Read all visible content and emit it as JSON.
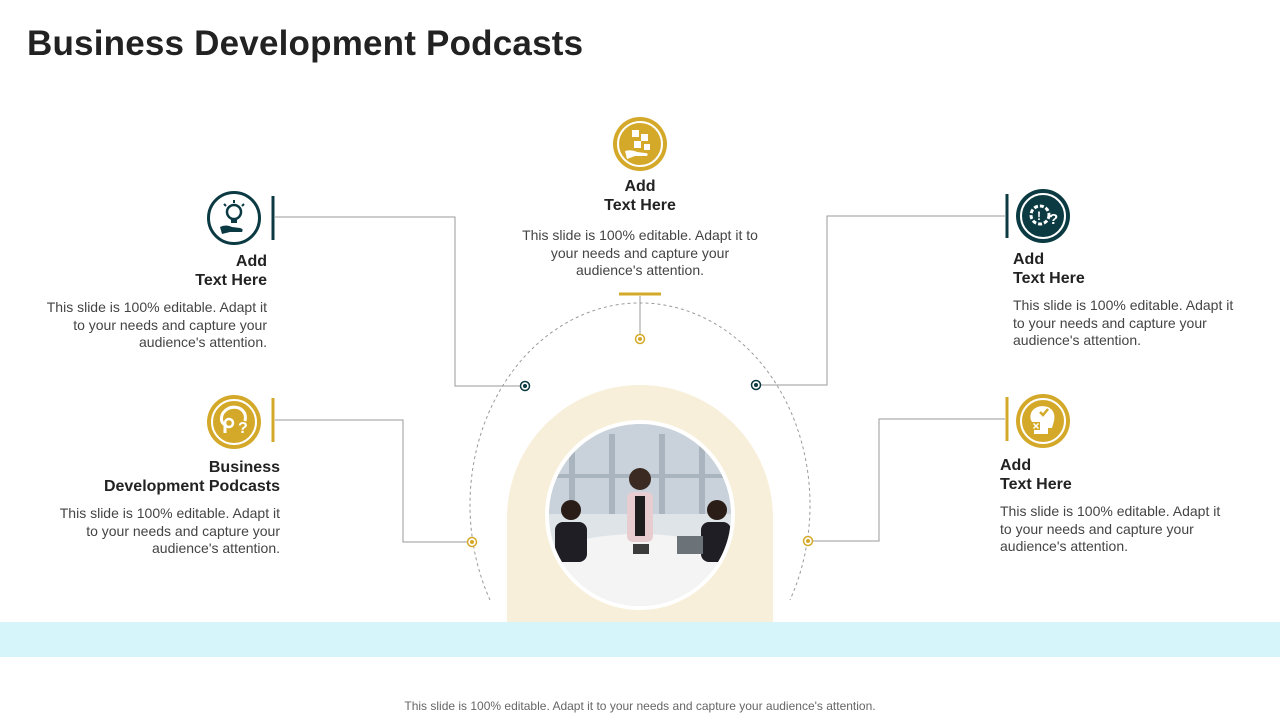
{
  "title": "Business Development Podcasts",
  "colors": {
    "gold": "#d4a92a",
    "teal": "#0b3a43",
    "band": "#d6f5fb",
    "arch": "#f7efd9"
  },
  "items": [
    {
      "id": "top",
      "icon": "puzzle-hand-icon",
      "heading_line1": "Add",
      "heading_line2": "Text Here",
      "desc": "This slide is 100% editable. Adapt it to your needs and capture your audience's attention."
    },
    {
      "id": "left-top",
      "icon": "lightbulb-hand-icon",
      "heading_line1": "Add",
      "heading_line2": "Text Here",
      "desc": "This slide is 100% editable. Adapt it to your needs and capture your audience's attention."
    },
    {
      "id": "left-bottom",
      "icon": "head-gear-question-icon",
      "heading_line1": "Business",
      "heading_line2": "Development Podcasts",
      "desc": "This slide is 100% editable. Adapt it to your needs and capture your audience's attention."
    },
    {
      "id": "right-top",
      "icon": "gear-question-icon",
      "heading_line1": "Add",
      "heading_line2": "Text Here",
      "desc": "This slide is 100% editable. Adapt it to your needs and capture your audience's attention."
    },
    {
      "id": "right-bottom",
      "icon": "head-check-cross-icon",
      "heading_line1": "Add",
      "heading_line2": "Text Here",
      "desc": "This slide is 100% editable. Adapt it to your needs and capture your audience's attention."
    }
  ],
  "center_image": "business-meeting-photo",
  "footer": "This slide is 100% editable. Adapt it to your needs and capture your audience's attention."
}
